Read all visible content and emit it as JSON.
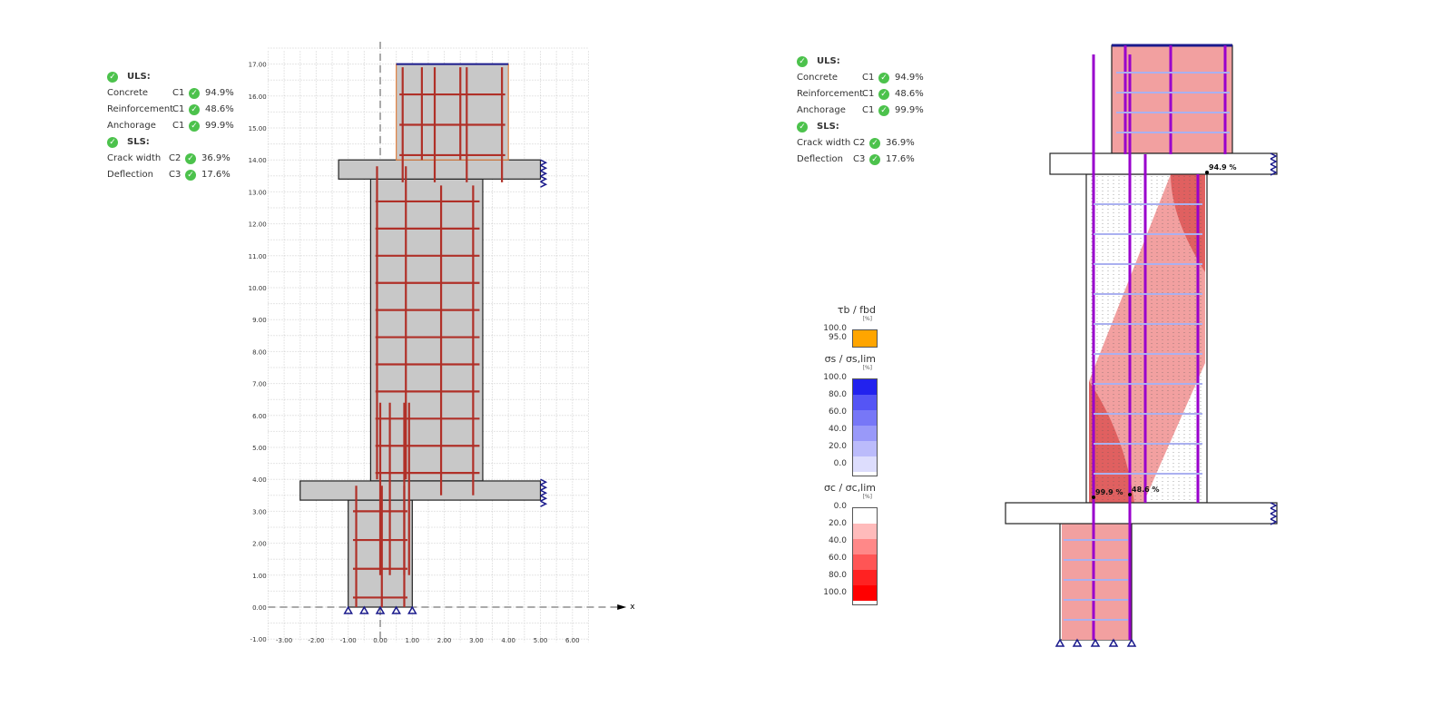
{
  "summary": {
    "uls_label": "ULS:",
    "sls_label": "SLS:",
    "uls": [
      {
        "name": "Concrete",
        "combo": "C1",
        "value": "94.9%"
      },
      {
        "name": "Reinforcement",
        "combo": "C1",
        "value": "48.6%"
      },
      {
        "name": "Anchorage",
        "combo": "C1",
        "value": "99.9%"
      }
    ],
    "sls": [
      {
        "name": "Crack width",
        "combo": "C2",
        "value": "36.9%"
      },
      {
        "name": "Deflection",
        "combo": "C3",
        "value": "17.6%"
      }
    ]
  },
  "axes": {
    "x_label": "x",
    "x_ticks": [
      "-3.00",
      "-2.00",
      "-1.00",
      "0.00",
      "1.00",
      "2.00",
      "3.00",
      "4.00",
      "5.00",
      "6.00"
    ],
    "y_ticks": [
      "-1.00",
      "0.00",
      "1.00",
      "2.00",
      "3.00",
      "4.00",
      "5.00",
      "6.00",
      "7.00",
      "8.00",
      "9.00",
      "10.00",
      "11.00",
      "12.00",
      "13.00",
      "14.00",
      "15.00",
      "16.00",
      "17.00"
    ]
  },
  "results": {
    "markers": [
      "94.9 %",
      "99.9 %",
      "48.6 %"
    ]
  },
  "legend": {
    "bond": {
      "title": "τb / fbd",
      "unit": "[%]",
      "labels": [
        "100.0",
        "95.0"
      ],
      "color": "#ffa500"
    },
    "steel": {
      "title": "σs / σs,lim",
      "unit": "[%]",
      "labels": [
        "100.0",
        "80.0",
        "60.0",
        "40.0",
        "20.0",
        "0.0"
      ],
      "colors": [
        "#2222ee",
        "#5555f5",
        "#7777f7",
        "#9999f9",
        "#bbbbfb",
        "#ddddfd"
      ]
    },
    "concrete": {
      "title": "σc / σc,lim",
      "unit": "[%]",
      "labels": [
        "0.0",
        "20.0",
        "40.0",
        "60.0",
        "80.0",
        "100.0"
      ],
      "colors": [
        "#ffffff",
        "#ffbbbb",
        "#ff8888",
        "#ff5555",
        "#ff2222",
        "#ff0000"
      ]
    }
  },
  "colors": {
    "concrete": "#c8c8c8",
    "rebar": "#b03028",
    "support": "#1a1a8c",
    "stress": "#f2a0a0",
    "tension": "#9900cc"
  }
}
